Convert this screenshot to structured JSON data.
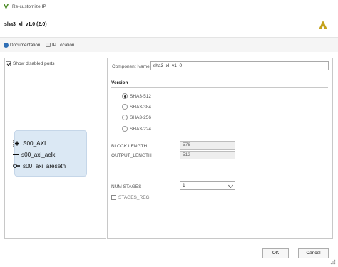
{
  "window": {
    "title": "Re-customize IP"
  },
  "header": {
    "ip_name": "sha3_xl_v1.0 (2.0)"
  },
  "toolbar": {
    "documentation_label": "Documentation",
    "location_label": "IP Location"
  },
  "left_panel": {
    "show_disabled_ports_label": "Show disabled ports",
    "show_disabled_ports_checked": true,
    "ports": [
      "S00_AXI",
      "s00_axi_aclk",
      "s00_axi_aresetn"
    ]
  },
  "right_panel": {
    "component_name_label": "Component Name",
    "component_name_value": "sha3_xl_v1_0",
    "version_header": "Version",
    "versions": [
      "SHA3-512",
      "SHA3-384",
      "SHA3-256",
      "SHA3-224"
    ],
    "selected_version": "SHA3-512",
    "block_length_label": "BLOCK LENGTH",
    "block_length_value": "576",
    "output_length_label": "OUTPUT_LENGTH",
    "output_length_value": "512",
    "num_stages_label": "NUM STAGES",
    "num_stages_value": "1",
    "stages_checkbox_label": "STAGES_REG",
    "stages_checkbox_checked": false
  },
  "buttons": {
    "ok": "OK",
    "cancel": "Cancel"
  },
  "colors": {
    "block_fill": "#dbe8f4",
    "accent": "#2f6fb5",
    "brand_logo": "#c4a21d"
  }
}
